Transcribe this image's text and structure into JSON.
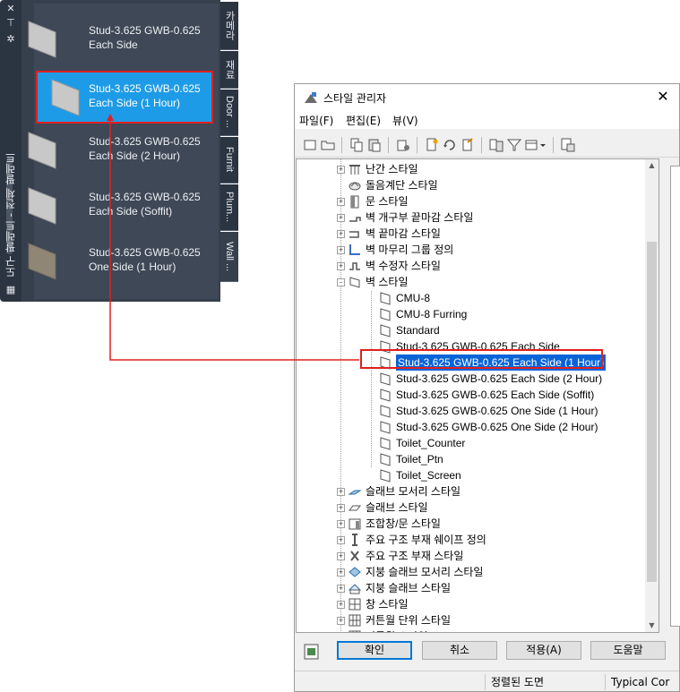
{
  "palette": {
    "title": "도구 팔레트 - 전체 팔레트",
    "items": [
      {
        "label": "Stud-3.625 GWB-0.625 Each Side"
      },
      {
        "label": "Stud-3.625 GWB-0.625 Each Side (1 Hour)"
      },
      {
        "label": "Stud-3.625 GWB-0.625 Each Side (2 Hour)"
      },
      {
        "label": "Stud-3.625 GWB-0.625 Each Side (Soffit)"
      },
      {
        "label": "Stud-3.625 GWB-0.625 One Side (1 Hour)"
      }
    ],
    "tabs": [
      {
        "label": "카메라"
      },
      {
        "label": "재료"
      },
      {
        "label": "Door ..."
      },
      {
        "label": "Furnit"
      },
      {
        "label": "Plum..."
      },
      {
        "label": "Wall ..."
      }
    ]
  },
  "dialog": {
    "title": "스타일 관리자",
    "close": "✕",
    "menu": [
      {
        "label": "파일(F)"
      },
      {
        "label": "편집(E)"
      },
      {
        "label": "뷰(V)"
      }
    ],
    "tree": [
      {
        "label": "난간 스타일"
      },
      {
        "label": "돌음계단 스타일"
      },
      {
        "label": "문 스타일"
      },
      {
        "label": "벽 개구부 끝마감 스타일"
      },
      {
        "label": "벽 끝마감 스타일"
      },
      {
        "label": "벽 마무리 그룹 정의"
      },
      {
        "label": "벽 수정자 스타일"
      },
      {
        "label": "벽 스타일"
      },
      {
        "label": "CMU-8"
      },
      {
        "label": "CMU-8 Furring"
      },
      {
        "label": "Standard"
      },
      {
        "label": "Stud-3.625 GWB-0.625 Each Side"
      },
      {
        "label": "Stud-3.625 GWB-0.625 Each Side (1 Hour)"
      },
      {
        "label": "Stud-3.625 GWB-0.625 Each Side (2 Hour)"
      },
      {
        "label": "Stud-3.625 GWB-0.625 Each Side (Soffit)"
      },
      {
        "label": "Stud-3.625 GWB-0.625 One Side (1 Hour)"
      },
      {
        "label": "Stud-3.625 GWB-0.625 One Side (2 Hour)"
      },
      {
        "label": "Toilet_Counter"
      },
      {
        "label": "Toilet_Ptn"
      },
      {
        "label": "Toilet_Screen"
      },
      {
        "label": "슬래브 모서리 스타일"
      },
      {
        "label": "슬래브 스타일"
      },
      {
        "label": "조합창/문 스타일"
      },
      {
        "label": "주요 구조 부재 쉐이프 정의"
      },
      {
        "label": "주요 구조 부재 스타일"
      },
      {
        "label": "지붕 슬래브 모서리 스타일"
      },
      {
        "label": "지붕 슬래브 스타일"
      },
      {
        "label": "창 스타일"
      },
      {
        "label": "커튼월 단위 스타일"
      },
      {
        "label": "커튼월 스타일"
      }
    ],
    "buttons": {
      "ok": "확인",
      "cancel": "취소",
      "apply": "적용(A)",
      "help": "도움말"
    },
    "status": {
      "left": "",
      "middle": "정렬된 도면",
      "right": "Typical Cor"
    }
  },
  "colors": {
    "palette_bg": "#36404d",
    "palette_selected": "#1e9be7",
    "highlight_border": "#e02020",
    "tree_selected": "#0a64d8"
  }
}
